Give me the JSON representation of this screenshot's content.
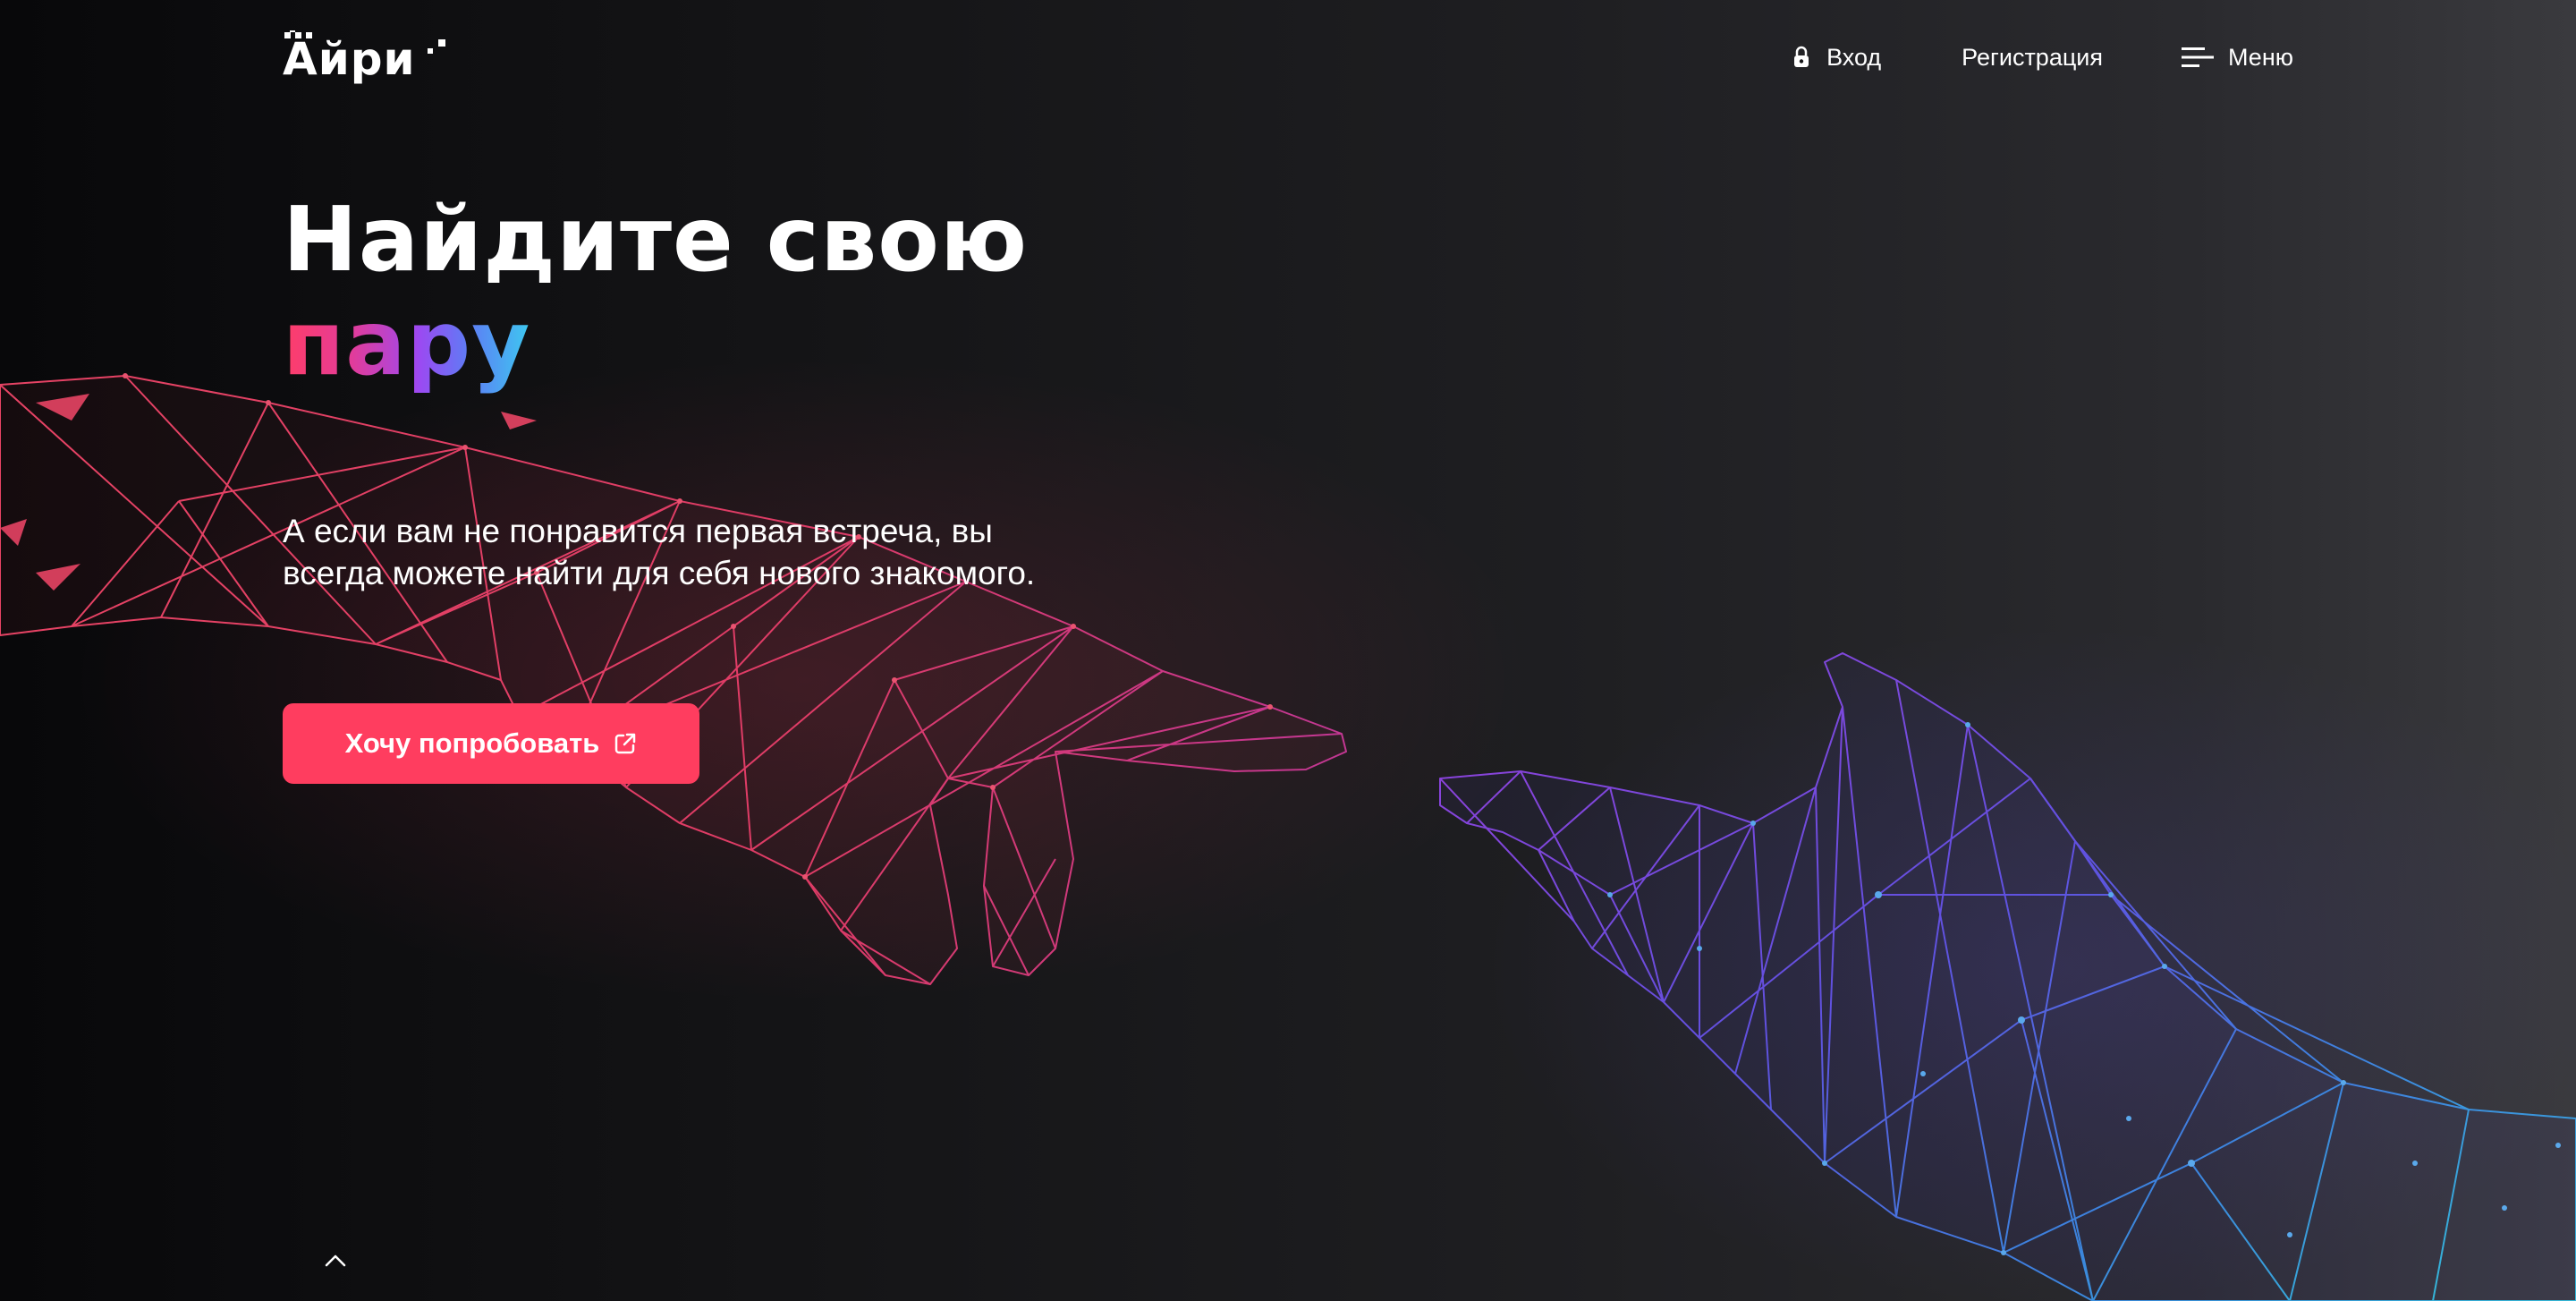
{
  "logo": {
    "text": "Айри"
  },
  "nav": {
    "login_label": "Вход",
    "register_label": "Регистрация",
    "menu_label": "Меню"
  },
  "hero": {
    "title_line1": "Найдите свою",
    "title_accent": "пару",
    "description": "А если вам не понравится первая встреча, вы всегда можете найти для себя нового знакомого.",
    "cta_label": "Хочу попробовать"
  },
  "icons": {
    "login": "lock-icon",
    "menu": "hamburger-menu-icon",
    "cta": "external-link-icon",
    "scroll": "chevron-up-icon"
  },
  "colors": {
    "background_dark": "#0a0a0c",
    "background_light": "#3a3a3e",
    "cta_button": "#ff3d5f",
    "accent_gradient": [
      "#ff3d68",
      "#e23c9a",
      "#9c49f2",
      "#5e7cf5",
      "#3dc9f0"
    ],
    "left_hand": "#ff3d5f",
    "right_hand": "#6d5cf0"
  }
}
